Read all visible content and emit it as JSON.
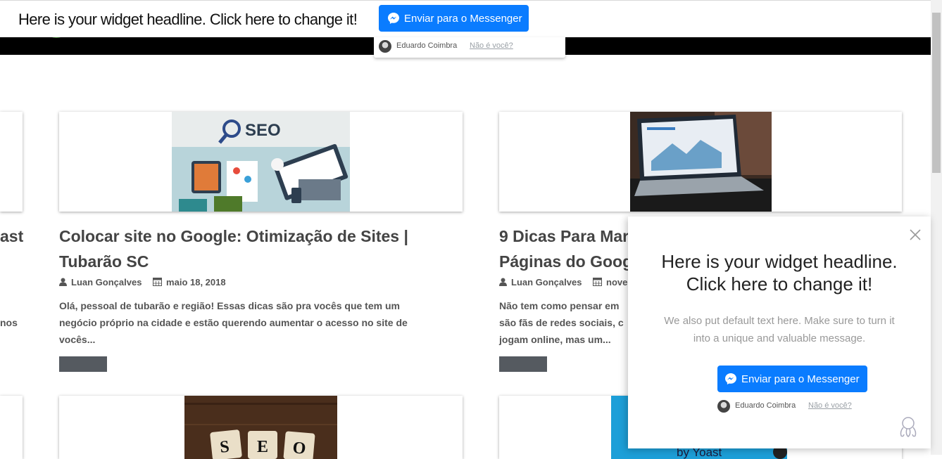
{
  "topbar": {
    "headline": "Here is your widget headline. Click here to change it!",
    "button_label": "Enviar para o Messenger",
    "user_name": "Eduardo Coimbra",
    "not_you": "Não é você?"
  },
  "posts": [
    {
      "title_line1": "Colocar site no Google: Otimização de Sites |",
      "title_line2": "Tubarão SC",
      "author": "Luan Gonçalves",
      "date": "maio 18, 2018",
      "excerpt_line1": "  Olá, pessoal de tubarão e região!   Essas dicas são pra vocês que tem um",
      "excerpt_line2": "negócio próprio na cidade e estão querendo aumentar o acesso no site de",
      "excerpt_line3": "vocês...",
      "image_text": "SEO"
    },
    {
      "title_line1": "9 Dicas Para Mar",
      "title_line2": "Páginas do Goog",
      "author": "Luan Gonçalves",
      "date": "nove",
      "excerpt_line1": "Não tem como pensar em",
      "excerpt_line2": "são fãs de redes sociais, c",
      "excerpt_line3": "jogam online, mas um..."
    }
  ],
  "left_partial": {
    "title_fragment": "ast",
    "excerpt_fragment": "nos"
  },
  "bottom_images": {
    "seo_tiles": [
      "S",
      "E",
      "O"
    ],
    "yoast_text": "by Yoast"
  },
  "popup": {
    "headline_line1": "Here is your widget headline.",
    "headline_line2": "Click here to change it!",
    "text_line1": "We also put default text here. Make sure to turn it",
    "text_line2": "into a unique and valuable message.",
    "button_label": "Enviar para o Messenger",
    "user_name": "Eduardo Coimbra",
    "not_you": "Não é você?"
  },
  "colors": {
    "messenger_blue": "#0a7cff",
    "title_text": "#444444",
    "read_more_bg": "#555a60"
  }
}
